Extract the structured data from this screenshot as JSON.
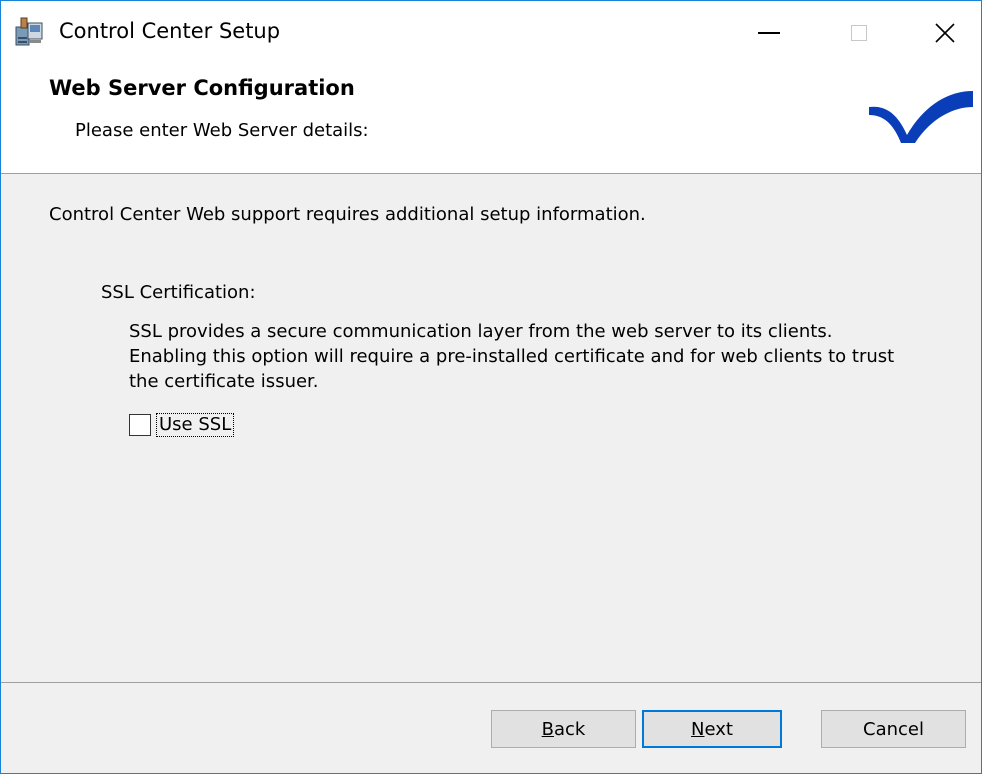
{
  "window": {
    "title": "Control Center Setup"
  },
  "header": {
    "title": "Web Server Configuration",
    "subtitle": "Please enter Web Server details:",
    "logo_color": "#0a3db8"
  },
  "body": {
    "intro": "Control Center Web support requires additional setup information.",
    "ssl_label": "SSL Certification:",
    "ssl_description": "SSL provides a secure communication layer from the web server to its clients. Enabling this option will require a pre-installed certificate and for web clients to trust the certificate issuer.",
    "use_ssl": {
      "label": "Use SSL",
      "checked": false
    }
  },
  "footer": {
    "back": {
      "mnemonic": "B",
      "rest": "ack"
    },
    "next": {
      "mnemonic": "N",
      "rest": "ext"
    },
    "cancel": "Cancel"
  },
  "icons": {
    "app": "installer-package-icon",
    "minimize": "minimize-icon",
    "maximize": "maximize-icon",
    "close": "close-icon"
  }
}
